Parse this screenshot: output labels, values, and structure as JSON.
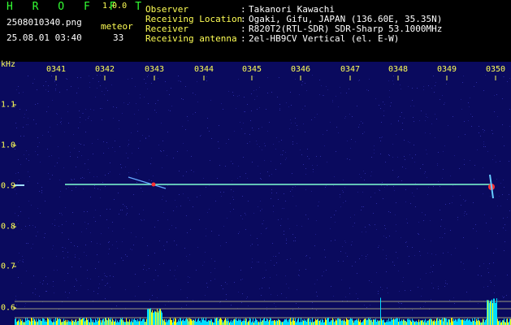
{
  "title": {
    "app_name": "H R O F F T",
    "version": "1.0.0",
    "filename": "2508010340.png",
    "timestamp": "25.08.01 03:40",
    "meteor_label": "meteor",
    "meteor_count": "33"
  },
  "info": [
    {
      "label": "Observer",
      "value": "Takanori Kawachi"
    },
    {
      "label": "Receiving Location",
      "value": "Ogaki, Gifu, JAPAN (136.60E, 35.35N)"
    },
    {
      "label": "Receiver",
      "value": "R820T2(RTL-SDR) SDR-Sharp 53.1000MHz"
    },
    {
      "label": "Receiving antenna",
      "value": "2el-HB9CV Vertical (el. E-W)"
    }
  ],
  "axis": {
    "unit": "kHz",
    "time_ticks": [
      "0341",
      "0342",
      "0343",
      "0344",
      "0345",
      "0346",
      "0347",
      "0348",
      "0349",
      "0350"
    ],
    "freq_ticks": [
      "1.1",
      "1.0",
      "0.9",
      "0.8",
      "0.7",
      "0.6"
    ]
  },
  "colors": {
    "background": "#0a0a5e",
    "label": "#ffff55",
    "info": "#ffffff",
    "brand": "#33ff33",
    "carrier": "#7fffd4",
    "echo": "#ff3333"
  }
}
